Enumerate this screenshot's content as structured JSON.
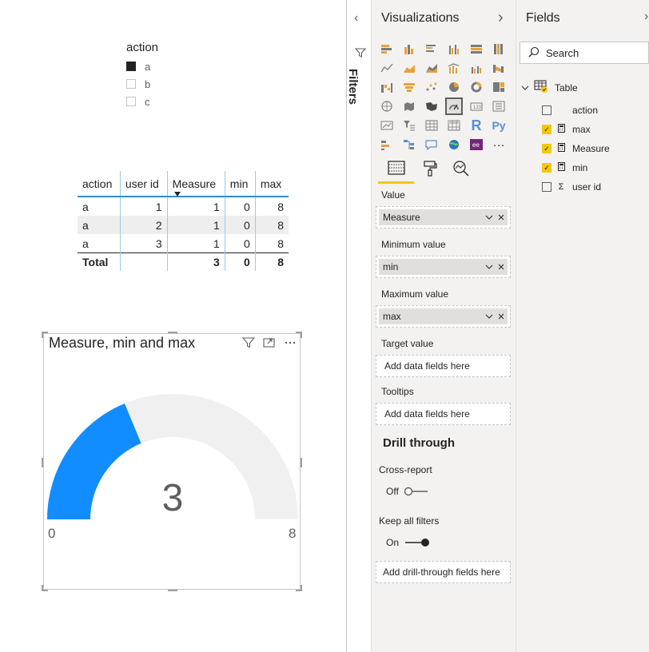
{
  "slicer": {
    "title": "action",
    "items": [
      {
        "label": "a",
        "checked": true
      },
      {
        "label": "b",
        "checked": false
      },
      {
        "label": "c",
        "checked": false
      }
    ]
  },
  "table": {
    "headers": [
      "action",
      "user id",
      "Measure",
      "min",
      "max"
    ],
    "rows": [
      [
        "a",
        "1",
        "1",
        "0",
        "8"
      ],
      [
        "a",
        "2",
        "1",
        "0",
        "8"
      ],
      [
        "a",
        "3",
        "1",
        "0",
        "8"
      ]
    ],
    "total": [
      "Total",
      "",
      "3",
      "0",
      "8"
    ]
  },
  "gauge": {
    "title": "Measure, min and max",
    "value": "3",
    "min": "0",
    "max": "8",
    "value_number": 3,
    "min_number": 0,
    "max_number": 8,
    "fill_color": "#118dff",
    "track_color": "#f0f0f0"
  },
  "filters_pane": {
    "label": "Filters"
  },
  "visualizations": {
    "title": "Visualizations",
    "value_label": "Value",
    "value_field": "Measure",
    "min_label": "Minimum value",
    "min_field": "min",
    "max_label": "Maximum value",
    "max_field": "max",
    "target_label": "Target value",
    "target_placeholder": "Add data fields here",
    "tooltips_label": "Tooltips",
    "tooltips_placeholder": "Add data fields here",
    "drill_title": "Drill through",
    "cross_report_label": "Cross-report",
    "cross_report_state": "Off",
    "keep_filters_label": "Keep all filters",
    "keep_filters_state": "On",
    "drill_placeholder": "Add drill-through fields here",
    "r_label": "R",
    "py_label": "Py",
    "more_label": "···"
  },
  "fields_pane": {
    "title": "Fields",
    "search_placeholder": "Search",
    "table_name": "Table",
    "fields": [
      {
        "name": "action",
        "checked": false,
        "type": ""
      },
      {
        "name": "max",
        "checked": true,
        "type": "calc"
      },
      {
        "name": "Measure",
        "checked": true,
        "type": "calc"
      },
      {
        "name": "min",
        "checked": true,
        "type": "calc"
      },
      {
        "name": "user id",
        "checked": false,
        "type": "sum"
      }
    ]
  },
  "colors": {
    "accent": "#f2c811",
    "table_header_line": "#2d8fc9"
  }
}
